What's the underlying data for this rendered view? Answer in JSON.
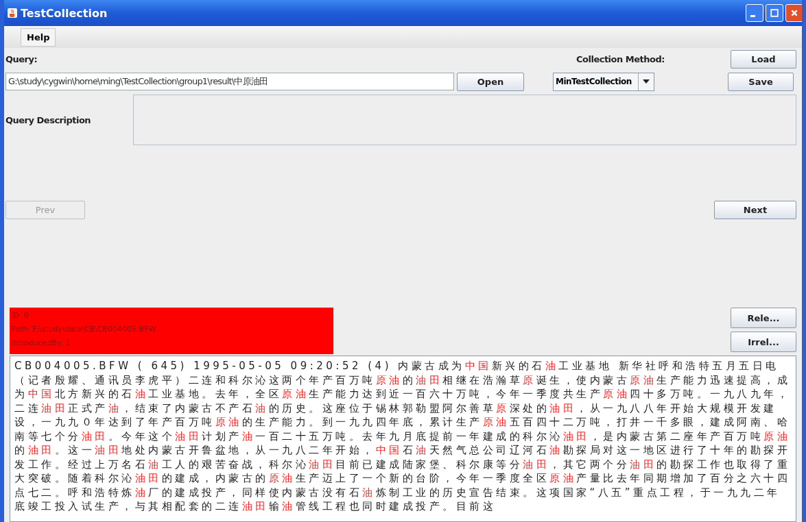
{
  "window": {
    "title": "TestCollection"
  },
  "menu": [
    {
      "label": "Help"
    }
  ],
  "query": {
    "label": "Query:",
    "value": "G:\\study\\cygwin\\home\\ming\\TestCollection\\group1\\result\\中原油田",
    "open_button": "Open"
  },
  "collection_method": {
    "label": "Collection Method:",
    "value": "MinTestCollection"
  },
  "buttons": {
    "load": "Load",
    "save": "Save",
    "prev": "Prev",
    "next": "Next",
    "relevant": "Rele...",
    "irrelevant": "Irrel..."
  },
  "prev_disabled": true,
  "query_description": {
    "label": "Query Description"
  },
  "info": [
    "ID: 0",
    "Path: F:\\study\\data\\CB\\CB004005.BFW",
    "IntroducedBy: 1"
  ],
  "document": [
    {
      "text": "CB004005.BFW ( 645) 1995-05-05 09:20:52 (4) 内蒙古成为",
      "highlight": false
    },
    {
      "text": "中国",
      "highlight": true
    },
    {
      "text": "新兴的石",
      "highlight": false
    },
    {
      "text": "油",
      "highlight": true
    },
    {
      "text": "工业基地 新华社呼和浩特五月五日电（记者殷耀、通讯员李虎平）二连和科尔沁这两个年产百万吨",
      "highlight": false
    },
    {
      "text": "原油",
      "highlight": true
    },
    {
      "text": "的",
      "highlight": false
    },
    {
      "text": "油田",
      "highlight": true
    },
    {
      "text": "相继在浩瀚草",
      "highlight": false
    },
    {
      "text": "原",
      "highlight": true
    },
    {
      "text": "诞生，使内蒙古",
      "highlight": false
    },
    {
      "text": "原油",
      "highlight": true
    },
    {
      "text": "生产能力迅速提高，成为",
      "highlight": false
    },
    {
      "text": "中国",
      "highlight": true
    },
    {
      "text": "北方新兴的石",
      "highlight": false
    },
    {
      "text": "油",
      "highlight": true
    },
    {
      "text": "工业基地。去年，全区",
      "highlight": false
    },
    {
      "text": "原油",
      "highlight": true
    },
    {
      "text": "生产能力达到近一百六十万吨，今年一季度共生产",
      "highlight": false
    },
    {
      "text": "原油",
      "highlight": true
    },
    {
      "text": "四十多万吨。一九八九年，二连",
      "highlight": false
    },
    {
      "text": "油田",
      "highlight": true
    },
    {
      "text": "正式产",
      "highlight": false
    },
    {
      "text": "油",
      "highlight": true
    },
    {
      "text": "，结束了内蒙古不产石",
      "highlight": false
    },
    {
      "text": "油",
      "highlight": true
    },
    {
      "text": "的历史。这座位于锡林郭勒盟阿尔善草",
      "highlight": false
    },
    {
      "text": "原",
      "highlight": true
    },
    {
      "text": "深处的",
      "highlight": false
    },
    {
      "text": "油田",
      "highlight": true
    },
    {
      "text": "，从一九八八年开始大规模开发建设，一九九０年达到了年产百万吨",
      "highlight": false
    },
    {
      "text": "原油",
      "highlight": true
    },
    {
      "text": "的生产能力。到一九九四年底，累计生产",
      "highlight": false
    },
    {
      "text": "原油",
      "highlight": true
    },
    {
      "text": "五百四十二万吨，打井一千多眼，建成阿南、哈南等七个分",
      "highlight": false
    },
    {
      "text": "油田",
      "highlight": true
    },
    {
      "text": "。今年这个",
      "highlight": false
    },
    {
      "text": "油田",
      "highlight": true
    },
    {
      "text": "计划产",
      "highlight": false
    },
    {
      "text": "油",
      "highlight": true
    },
    {
      "text": "一百二十五万吨。去年九月底提前一年建成的科尔沁",
      "highlight": false
    },
    {
      "text": "油田",
      "highlight": true
    },
    {
      "text": "，是内蒙古第二座年产百万吨",
      "highlight": false
    },
    {
      "text": "原油",
      "highlight": true
    },
    {
      "text": "的",
      "highlight": false
    },
    {
      "text": "油田",
      "highlight": true
    },
    {
      "text": "。这一",
      "highlight": false
    },
    {
      "text": "油田",
      "highlight": true
    },
    {
      "text": "地处内蒙古开鲁盆地，从一九八二年开始，",
      "highlight": false
    },
    {
      "text": "中国",
      "highlight": true
    },
    {
      "text": "石",
      "highlight": false
    },
    {
      "text": "油",
      "highlight": true
    },
    {
      "text": "天然气总公司辽河石",
      "highlight": false
    },
    {
      "text": "油",
      "highlight": true
    },
    {
      "text": "勘探局对这一地区进行了十年的勘探开发工作。经过上万名石",
      "highlight": false
    },
    {
      "text": "油",
      "highlight": true
    },
    {
      "text": "工人的艰苦奋战，科尔沁",
      "highlight": false
    },
    {
      "text": "油田",
      "highlight": true
    },
    {
      "text": "目前已建成陆家堡、科尔康等分",
      "highlight": false
    },
    {
      "text": "油田",
      "highlight": true
    },
    {
      "text": "，其它两个分",
      "highlight": false
    },
    {
      "text": "油田",
      "highlight": true
    },
    {
      "text": "的勘探工作也取得了重大突破。随着科尔沁",
      "highlight": false
    },
    {
      "text": "油田",
      "highlight": true
    },
    {
      "text": "的建成，内蒙古的",
      "highlight": false
    },
    {
      "text": "原油",
      "highlight": true
    },
    {
      "text": "生产迈上了一个新的台阶，今年一季度全区",
      "highlight": false
    },
    {
      "text": "原油",
      "highlight": true
    },
    {
      "text": "产量比去年同期增加了百分之六十四点七二。呼和浩特炼",
      "highlight": false
    },
    {
      "text": "油",
      "highlight": true
    },
    {
      "text": "厂的建成投产，同样使内蒙古没有石",
      "highlight": false
    },
    {
      "text": "油",
      "highlight": true
    },
    {
      "text": "炼制工业的历史宣告结束。这项国家“八五”重点工程，于一九九二年底竣工投入试生产，与其相配套的二连",
      "highlight": false
    },
    {
      "text": "油田",
      "highlight": true
    },
    {
      "text": "输",
      "highlight": false
    },
    {
      "text": "油",
      "highlight": true
    },
    {
      "text": "管线工程也同时建成投产。目前这",
      "highlight": false
    }
  ]
}
